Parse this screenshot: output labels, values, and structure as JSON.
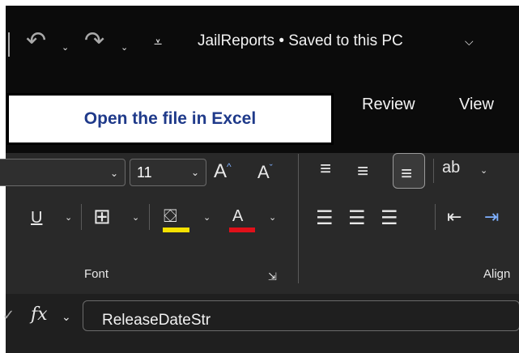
{
  "window": {
    "title": "JailReports • Saved to this PC"
  },
  "ribbon_tabs": [
    {
      "label": "Review"
    },
    {
      "label": "View"
    }
  ],
  "callout": {
    "text": "Open the file in Excel"
  },
  "font_group": {
    "font_size": "11",
    "label": "Font",
    "fill_color": "#f5e100",
    "font_color": "#e0101a"
  },
  "alignment_group": {
    "label": "Align"
  },
  "formula_bar": {
    "content": "ReleaseDateStr"
  }
}
